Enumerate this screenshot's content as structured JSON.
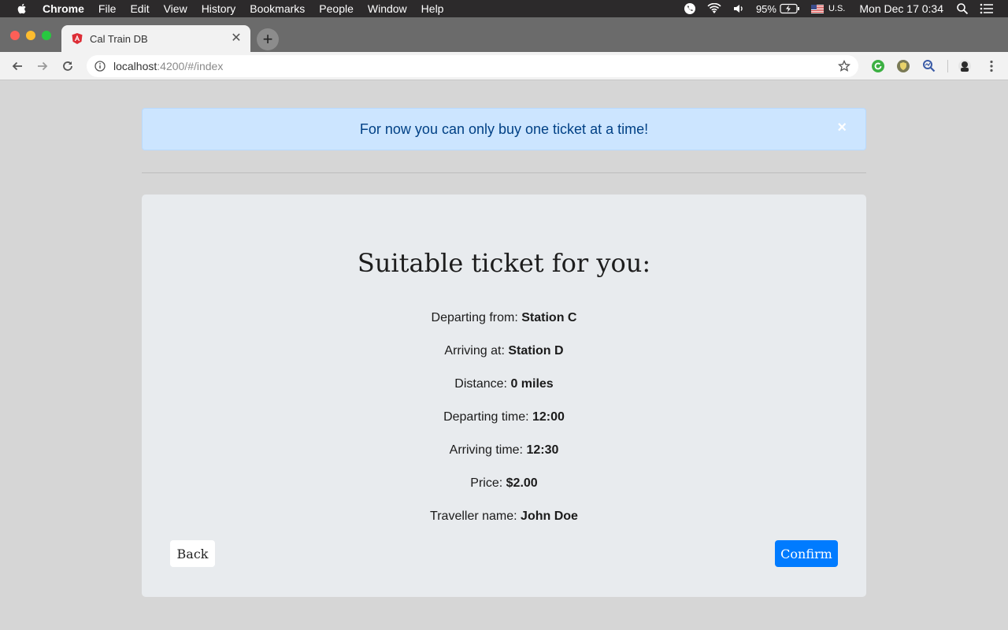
{
  "menubar": {
    "app": "Chrome",
    "items": [
      "File",
      "Edit",
      "View",
      "History",
      "Bookmarks",
      "People",
      "Window",
      "Help"
    ],
    "battery": "95%",
    "input_source": "U.S.",
    "datetime": "Mon Dec 17  0:34"
  },
  "browser": {
    "tab_title": "Cal Train DB",
    "url_host": "localhost",
    "url_rest": ":4200/#/index"
  },
  "alert": {
    "message": "For now you can only buy one ticket at a time!",
    "close": "×"
  },
  "ticket": {
    "title": "Suitable ticket for you:",
    "rows": [
      {
        "label": "Departing from: ",
        "value": "Station C"
      },
      {
        "label": "Arriving at: ",
        "value": "Station D"
      },
      {
        "label": "Distance: ",
        "value": "0 miles"
      },
      {
        "label": "Departing time: ",
        "value": "12:00"
      },
      {
        "label": "Arriving time: ",
        "value": "12:30"
      },
      {
        "label": "Price: ",
        "value": "$2.00"
      },
      {
        "label": "Traveller name: ",
        "value": "John Doe"
      }
    ],
    "back_label": "Back",
    "confirm_label": "Confirm"
  },
  "colors": {
    "alert_bg": "#cce5ff",
    "alert_text": "#004085",
    "primary": "#007bff"
  }
}
